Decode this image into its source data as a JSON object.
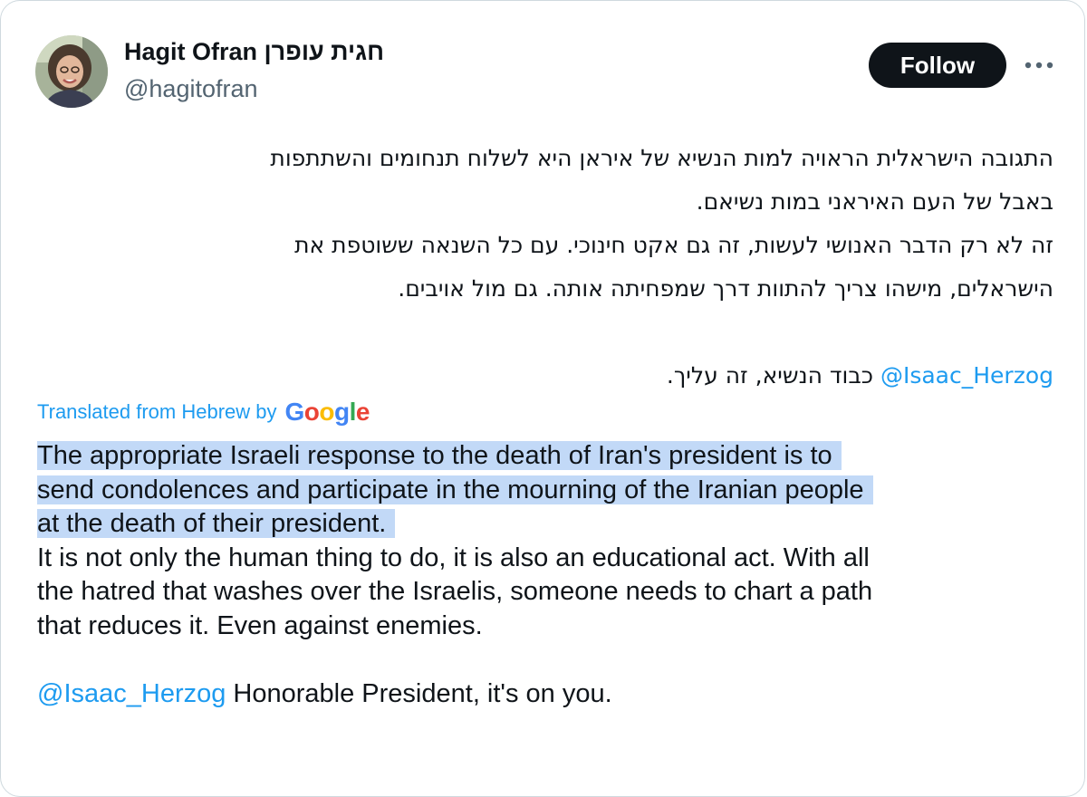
{
  "author": {
    "name": "Hagit Ofran חגית עופרן",
    "handle": "@hagitofran"
  },
  "actions": {
    "follow_label": "Follow",
    "more_label": "···"
  },
  "icons": {
    "avatar": "profile-photo",
    "more": "more-horizontal-icon"
  },
  "original_text": {
    "lines": [
      "התגובה הישראלית הראויה למות הנשיא של איראן היא לשלוח תנחומים והשתתפות",
      "באבל של העם האיראני במות נשיאם.",
      "זה לא רק הדבר האנושי לעשות, זה גם אקט חינוכי. עם כל השנאה ששוטפת את",
      "הישראלים, מישהו צריך להתוות דרך שמפחיתה אותה. גם מול אויבים."
    ],
    "mention": "@Isaac_Herzog",
    "last_line_text": " כבוד הנשיא, זה עליך."
  },
  "translation": {
    "label": "Translated from Hebrew by",
    "provider": "Google",
    "highlighted_lines": [
      "The appropriate Israeli response to the death of Iran's president is to",
      "send condolences and participate in the mourning of the Iranian people",
      "at the death of their president."
    ],
    "lines": [
      "It is not only the human thing to do, it is also an educational act. With all",
      "the hatred that washes over the Israelis, someone needs to chart a path",
      "that reduces it. Even against enemies."
    ],
    "mention": "@Isaac_Herzog",
    "last_line_text": " Honorable President, it's on you."
  },
  "colors": {
    "link": "#1d9bf0",
    "text": "#0f1419",
    "secondary": "#536471",
    "highlight": "#c2d9f7",
    "button_bg": "#0f1419",
    "border": "#cfd9de"
  }
}
